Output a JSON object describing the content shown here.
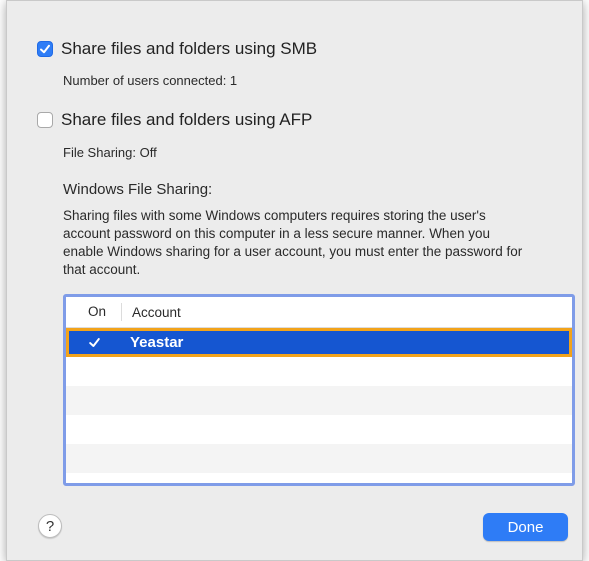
{
  "smb": {
    "label": "Share files and folders using SMB",
    "checked": true,
    "status": "Number of users connected: 1"
  },
  "afp": {
    "label": "Share files and folders using AFP",
    "checked": false,
    "status": "File Sharing: Off"
  },
  "windows": {
    "title": "Windows File Sharing:",
    "description": "Sharing files with some Windows computers requires storing the user's account password on this computer in a less secure manner. When you enable Windows sharing for a user account, you must enter the password for that account."
  },
  "table": {
    "headers": {
      "on": "On",
      "account": "Account"
    },
    "rows": [
      {
        "on": true,
        "account": "Yeastar"
      }
    ]
  },
  "buttons": {
    "help": "?",
    "done": "Done"
  },
  "colors": {
    "accent": "#2e7cf6",
    "selection": "#1556d1",
    "highlight": "#f2a31b"
  }
}
